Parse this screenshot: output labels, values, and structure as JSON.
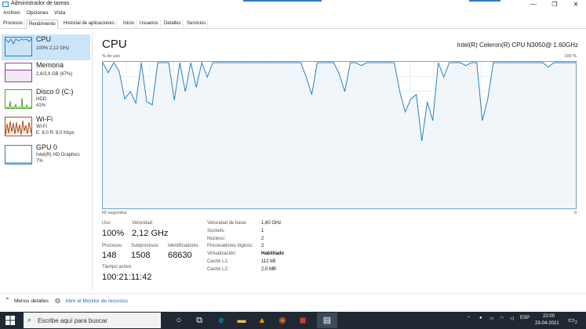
{
  "window": {
    "title": "Administrador de tareas",
    "controls": [
      "—",
      "❐",
      "✕"
    ]
  },
  "menu": [
    "Archivo",
    "Opciones",
    "Vista"
  ],
  "tabs": [
    "Procesos",
    "Rendimiento",
    "Historial de aplicaciones",
    "Inicio",
    "Usuarios",
    "Detalles",
    "Servicios"
  ],
  "active_tab": "Rendimiento",
  "sidebar": [
    {
      "name": "CPU",
      "sub": [
        "100%  2,12 GHz"
      ]
    },
    {
      "name": "Memoria",
      "sub": [
        "2,6/3,9 GB (67%)"
      ]
    },
    {
      "name": "Disco 0 (C:)",
      "sub": [
        "HDD",
        "41%"
      ]
    },
    {
      "name": "Wi-Fi",
      "sub": [
        "Wi-Fi",
        "E: 8,0  R: 8,0 Kbps"
      ]
    },
    {
      "name": "GPU 0",
      "sub": [
        "Intel(R) HD Graphics",
        "7%"
      ]
    }
  ],
  "main": {
    "title": "CPU",
    "model": "Intel(R) Celeron(R) CPU N3050@ 1.60GHz",
    "graph_top_left": "% de uso",
    "graph_top_right": "100 %",
    "graph_bottom_left": "60 segundos",
    "graph_bottom_right": "0",
    "stats": {
      "uso_label": "Uso",
      "uso_value": "100%",
      "velocidad_label": "Velocidad",
      "velocidad_value": "2,12 GHz",
      "procesos_label": "Procesos",
      "procesos_value": "148",
      "subprocesos_label": "Subprocesos",
      "subprocesos_value": "1508",
      "identificadores_label": "Identificadores",
      "identificadores_value": "68630",
      "tiempo_label": "Tiempo activo",
      "tiempo_value": "100:21:11:42"
    },
    "info": [
      {
        "label": "Velocidad de base:",
        "value": "1,60 GHz"
      },
      {
        "label": "Sockets:",
        "value": "1"
      },
      {
        "label": "Núcleos:",
        "value": "2"
      },
      {
        "label": "Procesadores lógicos:",
        "value": "2"
      },
      {
        "label": "Virtualización:",
        "value": "Habilitado"
      },
      {
        "label": "Caché L1:",
        "value": "112 kB"
      },
      {
        "label": "Caché L2:",
        "value": "2,0 MB"
      }
    ]
  },
  "footer": {
    "less_details": "Menos detalles",
    "resource_monitor": "Abrir el Monitor de recursos"
  },
  "taskbar": {
    "search_placeholder": "Escribe aquí para buscar",
    "lang": "ESP",
    "time": "22:00",
    "date": "23-04-2021",
    "notifications": "2"
  },
  "colors": {
    "accent": "#2b79d0",
    "cpu_line": "#2d7fc1",
    "cpu_fill": "#f1f6fb",
    "memory": "#8b3e9e",
    "disk": "#4ea72e",
    "wifi": "#a7501b",
    "gpu": "#2d7fc1",
    "taskbar": "#1f2833"
  },
  "cpu_history": [
    100,
    93,
    100,
    94,
    75,
    80,
    72,
    100,
    73,
    71,
    100,
    100,
    100,
    74,
    100,
    80,
    100,
    83,
    100,
    90,
    100,
    100,
    100,
    100,
    100,
    100,
    100,
    100,
    100,
    100,
    100,
    100,
    100,
    100,
    100,
    100,
    100,
    90,
    78,
    100,
    100,
    100,
    100,
    92,
    80,
    100,
    100,
    98,
    100,
    100,
    100,
    100,
    100,
    100,
    80,
    66,
    75,
    78,
    46,
    73,
    60,
    100,
    90,
    100,
    100,
    100,
    98,
    100,
    100,
    60,
    75,
    100,
    100,
    100,
    100,
    100,
    100,
    100,
    100,
    100,
    100,
    97,
    100,
    100,
    100,
    100,
    100
  ]
}
